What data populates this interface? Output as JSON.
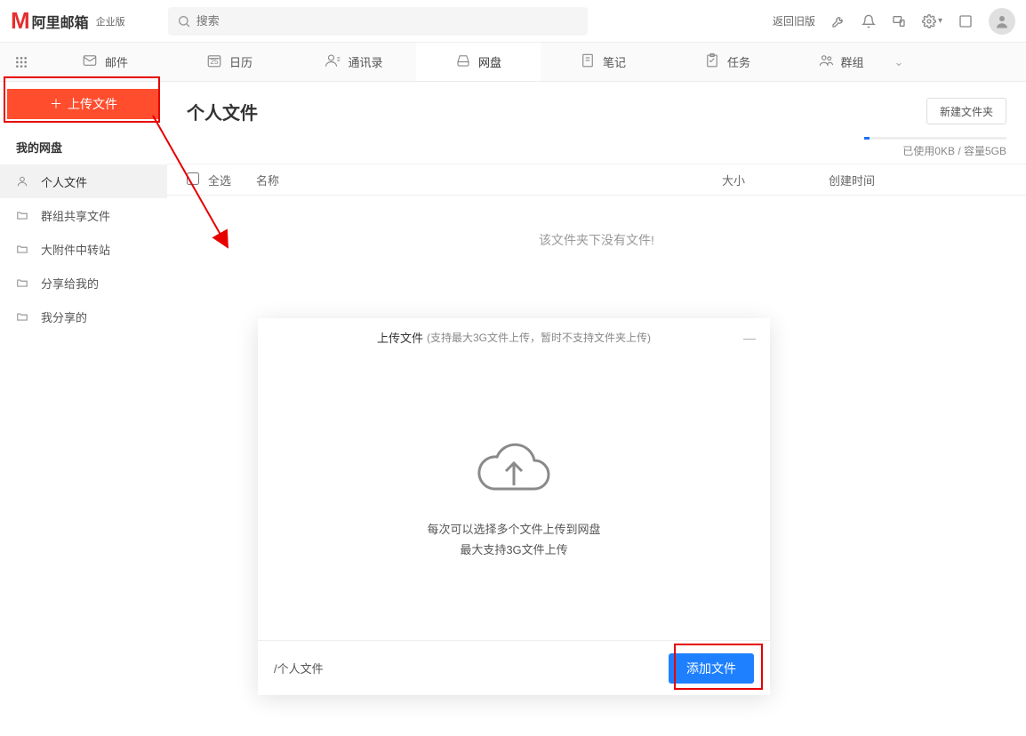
{
  "header": {
    "brand": "阿里邮箱",
    "edition": "企业版",
    "search_placeholder": "搜索",
    "back_old": "返回旧版"
  },
  "nav": {
    "mail": "邮件",
    "calendar": "日历",
    "calendar_day": "25",
    "contacts": "通讯录",
    "drive": "网盘",
    "notes": "笔记",
    "tasks": "任务",
    "groups": "群组"
  },
  "sidebar": {
    "upload_label": "上传文件",
    "section_title": "我的网盘",
    "items": [
      {
        "label": "个人文件"
      },
      {
        "label": "群组共享文件"
      },
      {
        "label": "大附件中转站"
      },
      {
        "label": "分享给我的"
      },
      {
        "label": "我分享的"
      }
    ]
  },
  "content": {
    "title": "个人文件",
    "new_folder": "新建文件夹",
    "quota": "已使用0KB / 容量5GB",
    "columns": {
      "select_all": "全选",
      "name": "名称",
      "size": "大小",
      "created": "创建时间"
    },
    "empty": "该文件夹下没有文件!"
  },
  "dialog": {
    "title": "上传文件",
    "title_hint": "(支持最大3G文件上传，暂时不支持文件夹上传)",
    "line1": "每次可以选择多个文件上传到网盘",
    "line2": "最大支持3G文件上传",
    "path": "/个人文件",
    "add_file": "添加文件"
  }
}
